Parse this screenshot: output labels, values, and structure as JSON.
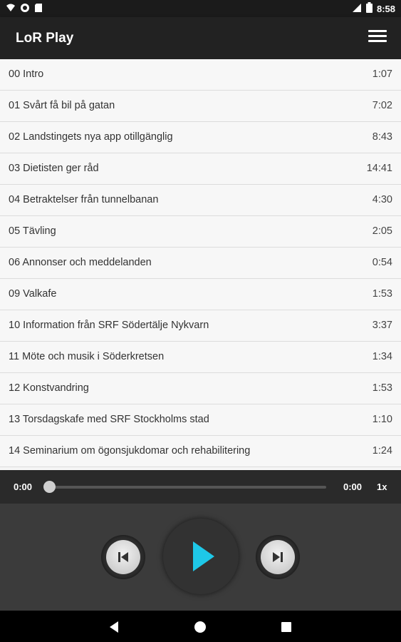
{
  "status_bar": {
    "time": "8:58",
    "icons": [
      "wifi-icon",
      "circle-icon",
      "sd-card-icon",
      "signal-icon",
      "battery-icon"
    ]
  },
  "app_bar": {
    "title": "LoR Play",
    "menu_icon": "hamburger-menu-icon"
  },
  "tracks": [
    {
      "title": "00 Intro",
      "duration": "1:07"
    },
    {
      "title": "01 Svårt få bil på gatan",
      "duration": "7:02"
    },
    {
      "title": "02 Landstingets nya app otillgänglig",
      "duration": "8:43"
    },
    {
      "title": "03 Dietisten ger råd",
      "duration": "14:41"
    },
    {
      "title": "04 Betraktelser från tunnelbanan",
      "duration": "4:30"
    },
    {
      "title": "05 Tävling",
      "duration": "2:05"
    },
    {
      "title": "06 Annonser och meddelanden",
      "duration": "0:54"
    },
    {
      "title": "09 Valkafe",
      "duration": "1:53"
    },
    {
      "title": "10 Information från SRF Södertälje Nykvarn",
      "duration": "3:37"
    },
    {
      "title": "11 Möte och musik i Söderkretsen",
      "duration": "1:34"
    },
    {
      "title": "12 Konstvandring",
      "duration": "1:53"
    },
    {
      "title": "13 Torsdagskafe med SRF Stockholms stad",
      "duration": "1:10"
    },
    {
      "title": "14 Seminarium om ögonsjukdomar och rehabilitering",
      "duration": "1:24"
    }
  ],
  "player": {
    "current_time": "0:00",
    "total_time": "0:00",
    "speed": "1x",
    "progress": 0,
    "accent": "#1ec8e8"
  },
  "nav": {
    "icons": [
      "back-icon",
      "home-icon",
      "recents-icon"
    ]
  }
}
